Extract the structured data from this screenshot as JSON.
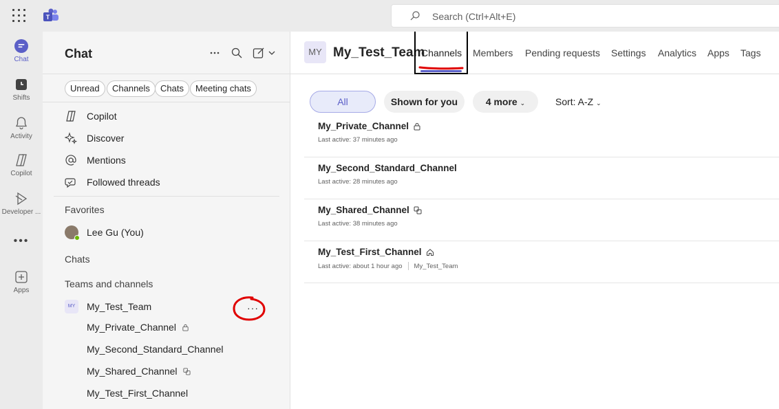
{
  "search": {
    "placeholder": "Search (Ctrl+Alt+E)"
  },
  "rail": [
    {
      "label": "Chat",
      "icon": "chat-icon",
      "active": true
    },
    {
      "label": "Shifts",
      "icon": "shifts-icon"
    },
    {
      "label": "Activity",
      "icon": "bell-icon"
    },
    {
      "label": "Copilot",
      "icon": "copilot-icon"
    },
    {
      "label": "Developer ...",
      "icon": "developer-portal-icon"
    },
    {
      "label": "",
      "icon": "more-apps-icon"
    },
    {
      "label": "Apps",
      "icon": "add-apps-icon"
    }
  ],
  "chat_panel": {
    "title": "Chat",
    "filters": [
      "Unread",
      "Channels",
      "Chats",
      "Meeting chats"
    ],
    "nav": [
      {
        "label": "Copilot",
        "icon": "copilot-icon"
      },
      {
        "label": "Discover",
        "icon": "sparkle-icon"
      },
      {
        "label": "Mentions",
        "icon": "at-icon"
      },
      {
        "label": "Followed threads",
        "icon": "followed-threads-icon"
      }
    ],
    "favorites_label": "Favorites",
    "favorite_user": "Lee Gu (You)",
    "chats_label": "Chats",
    "teams_label": "Teams and channels",
    "team": {
      "initials": "MY",
      "name": "My_Test_Team",
      "more": "···"
    },
    "channels": [
      {
        "name": "My_Private_Channel",
        "icon": "lock-icon"
      },
      {
        "name": "My_Second_Standard_Channel",
        "icon": ""
      },
      {
        "name": "My_Shared_Channel",
        "icon": "shared-icon"
      },
      {
        "name": "My_Test_First_Channel",
        "icon": ""
      }
    ]
  },
  "main": {
    "team_initials": "MY",
    "team_name": "My_Test_Team",
    "tabs": [
      "Channels",
      "Members",
      "Pending requests",
      "Settings",
      "Analytics",
      "Apps",
      "Tags"
    ],
    "active_tab": "Channels",
    "filters": {
      "all": "All",
      "shown": "Shown for you",
      "more": "4 more",
      "sort": "Sort: A-Z"
    },
    "channels": [
      {
        "name": "My_Private_Channel",
        "icon": "lock-icon",
        "meta": "Last active: 37 minutes ago",
        "extra": ""
      },
      {
        "name": "My_Second_Standard_Channel",
        "icon": "",
        "meta": "Last active: 28 minutes ago",
        "extra": ""
      },
      {
        "name": "My_Shared_Channel",
        "icon": "shared-icon",
        "meta": "Last active: 38 minutes ago",
        "extra": ""
      },
      {
        "name": "My_Test_First_Channel",
        "icon": "home-icon",
        "meta": "Last active: about 1 hour ago",
        "extra": "My_Test_Team"
      }
    ]
  },
  "colors": {
    "accent": "#5b5fc7",
    "annotation": "#e00000"
  }
}
